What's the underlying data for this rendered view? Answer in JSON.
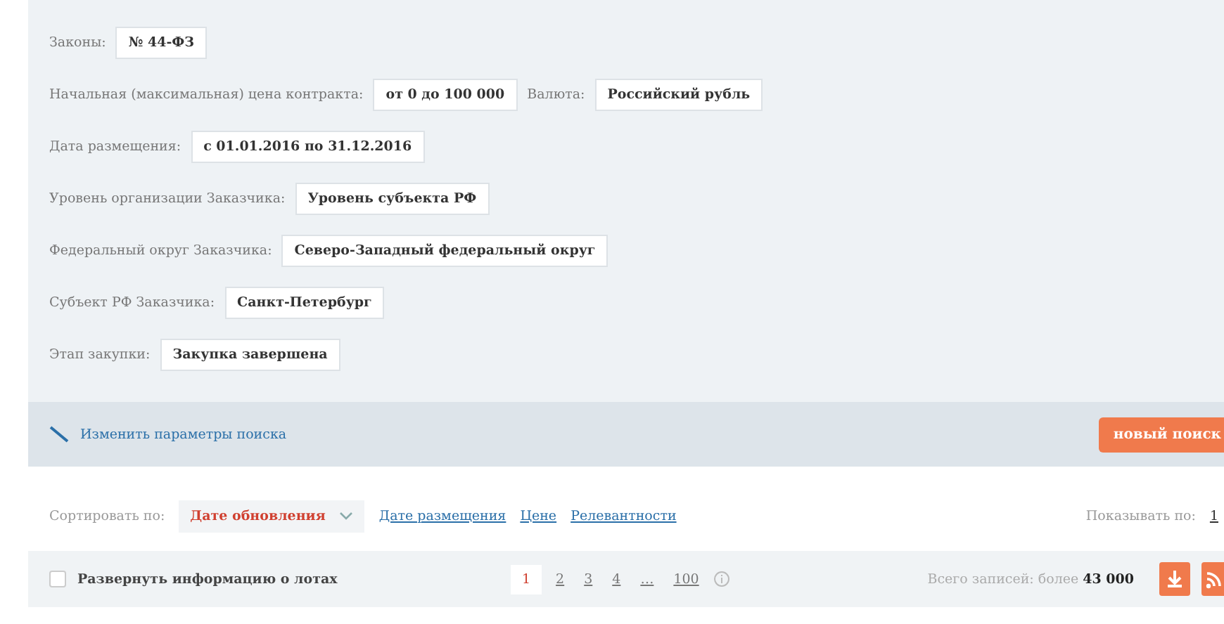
{
  "filters": [
    {
      "label": "Законы:",
      "values": [
        "№ 44-ФЗ"
      ]
    },
    {
      "label": "Начальная (максимальная) цена контракта:",
      "values": [
        "от 0 до 100 000"
      ],
      "extra_label": "Валюта:",
      "extra_values": [
        "Российский рубль"
      ]
    },
    {
      "label": "Дата размещения:",
      "values": [
        "с 01.01.2016 по 31.12.2016"
      ]
    },
    {
      "label": "Уровень организации Заказчика:",
      "values": [
        "Уровень субъекта РФ"
      ]
    },
    {
      "label": "Федеральный округ Заказчика:",
      "values": [
        "Северо-Западный федеральный округ"
      ]
    },
    {
      "label": "Субъект РФ Заказчика:",
      "values": [
        "Санкт-Петербург"
      ]
    },
    {
      "label": "Этап закупки:",
      "values": [
        "Закупка завершена"
      ]
    }
  ],
  "search_bar": {
    "edit_link": "Изменить параметры поиска",
    "new_search_button": "новый поиск"
  },
  "sort": {
    "label": "Сортировать по:",
    "options": [
      {
        "label": "Дате обновления",
        "selected": true
      },
      {
        "label": "Дате размещения",
        "selected": false
      },
      {
        "label": "Цене",
        "selected": false
      },
      {
        "label": "Релевантности",
        "selected": false
      }
    ],
    "per_page_label": "Показывать по:",
    "per_page_value": "1"
  },
  "results_bar": {
    "expand": {
      "label": "Развернуть информацию о лотах",
      "checked": false
    },
    "pages": [
      {
        "label": "1",
        "selected": true
      },
      {
        "label": "2",
        "selected": false
      },
      {
        "label": "3",
        "selected": false
      },
      {
        "label": "4",
        "selected": false
      },
      {
        "label": "…",
        "selected": false
      },
      {
        "label": "100",
        "selected": false
      }
    ],
    "total": "Всего записей: более **43 000**"
  }
}
